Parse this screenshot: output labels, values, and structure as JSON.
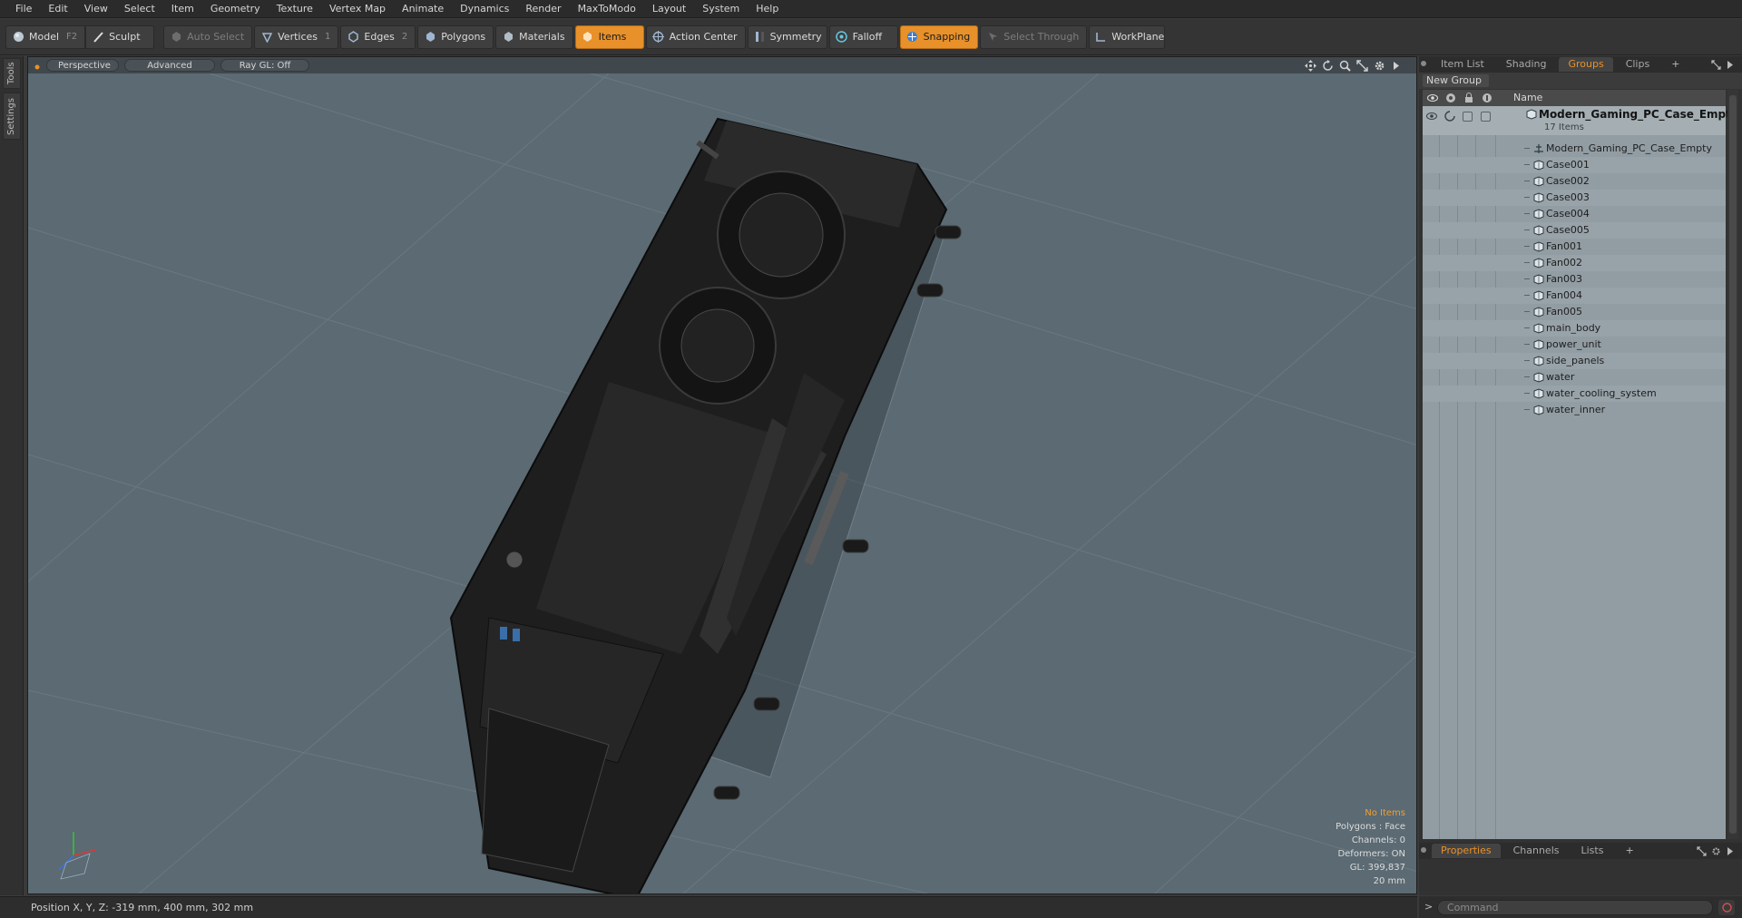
{
  "menu": [
    "File",
    "Edit",
    "View",
    "Select",
    "Item",
    "Geometry",
    "Texture",
    "Vertex Map",
    "Animate",
    "Dynamics",
    "Render",
    "MaxToModo",
    "Layout",
    "System",
    "Help"
  ],
  "toolbar": {
    "model": "Model",
    "model_key": "F2",
    "sculpt": "Sculpt",
    "auto_select": "Auto Select",
    "vertices": "Vertices",
    "vertices_key": "1",
    "edges": "Edges",
    "edges_key": "2",
    "polygons": "Polygons",
    "materials": "Materials",
    "items": "Items",
    "action_center": "Action Center",
    "symmetry": "Symmetry",
    "falloff": "Falloff",
    "snapping": "Snapping",
    "select_through": "Select Through",
    "workplane": "WorkPlane"
  },
  "left_tabs": [
    "Tools",
    "Settings"
  ],
  "viewport": {
    "perspective": "Perspective",
    "advanced": "Advanced",
    "raygl": "Ray GL: Off",
    "info": {
      "no_items": "No Items",
      "polygons": "Polygons : Face",
      "channels": "Channels: 0",
      "deformers": "Deformers: ON",
      "gl": "GL: 399,837",
      "scale": "20 mm"
    }
  },
  "panel": {
    "tabs": [
      "Item List",
      "Shading",
      "Groups",
      "Clips"
    ],
    "active_tab": "Groups",
    "new_group": "New Group",
    "column_name": "Name",
    "group": {
      "name": "Modern_Gaming_PC_Case_Empty",
      "count": "17 Items"
    },
    "items": [
      "Modern_Gaming_PC_Case_Empty",
      "Case001",
      "Case002",
      "Case003",
      "Case004",
      "Case005",
      "Fan001",
      "Fan002",
      "Fan003",
      "Fan004",
      "Fan005",
      "main_body",
      "power_unit",
      "side_panels",
      "water",
      "water_cooling_system",
      "water_inner"
    ],
    "bottom_tabs": [
      "Properties",
      "Channels",
      "Lists"
    ],
    "active_bottom_tab": "Properties"
  },
  "status": {
    "position": "Position X, Y, Z:   -319 mm, 400 mm, 302 mm"
  },
  "command": {
    "placeholder": "Command",
    "prompt": ">"
  },
  "colors": {
    "accent": "#e8912a",
    "viewport_bg": "#5b6a73",
    "tree_bg": "#929da3"
  }
}
